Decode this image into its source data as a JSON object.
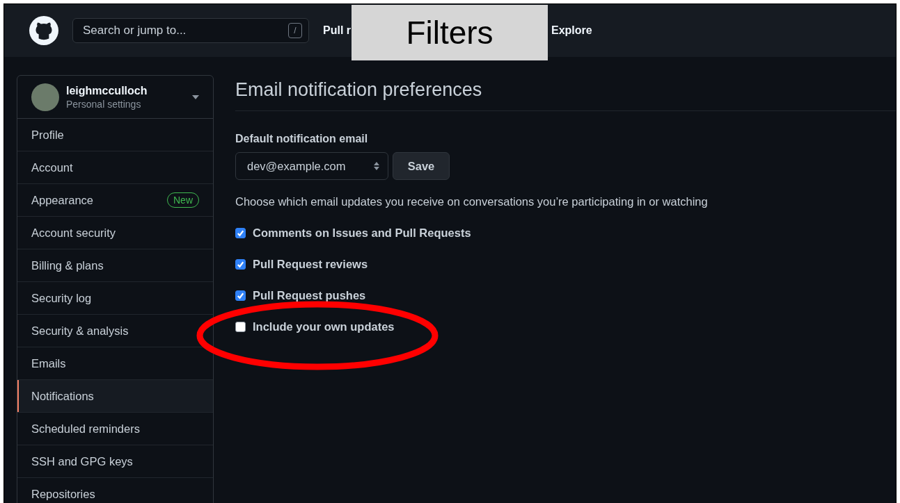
{
  "header": {
    "search": {
      "placeholder": "Search or jump to...",
      "shortcut": "/"
    },
    "nav": [
      "Pull r",
      "Explore"
    ]
  },
  "overlay_label": "Filters",
  "sidebar": {
    "user": {
      "name": "leighmcculloch",
      "subtitle": "Personal settings"
    },
    "items": [
      {
        "label": "Profile",
        "selected": false
      },
      {
        "label": "Account",
        "selected": false
      },
      {
        "label": "Appearance",
        "badge": "New",
        "selected": false
      },
      {
        "label": "Account security",
        "selected": false
      },
      {
        "label": "Billing & plans",
        "selected": false
      },
      {
        "label": "Security log",
        "selected": false
      },
      {
        "label": "Security & analysis",
        "selected": false
      },
      {
        "label": "Emails",
        "selected": false
      },
      {
        "label": "Notifications",
        "selected": true
      },
      {
        "label": "Scheduled reminders",
        "selected": false
      },
      {
        "label": "SSH and GPG keys",
        "selected": false
      },
      {
        "label": "Repositories",
        "selected": false
      }
    ]
  },
  "main": {
    "title": "Email notification preferences",
    "email_label": "Default notification email",
    "email_select": {
      "value": "dev@example.com"
    },
    "save_button": "Save",
    "description": "Choose which email updates you receive on conversations you’re participating in or watching",
    "options": [
      {
        "label": "Comments on Issues and Pull Requests",
        "checked": true
      },
      {
        "label": "Pull Request reviews",
        "checked": true
      },
      {
        "label": "Pull Request pushes",
        "checked": true
      },
      {
        "label": "Include your own updates",
        "checked": false
      }
    ]
  }
}
